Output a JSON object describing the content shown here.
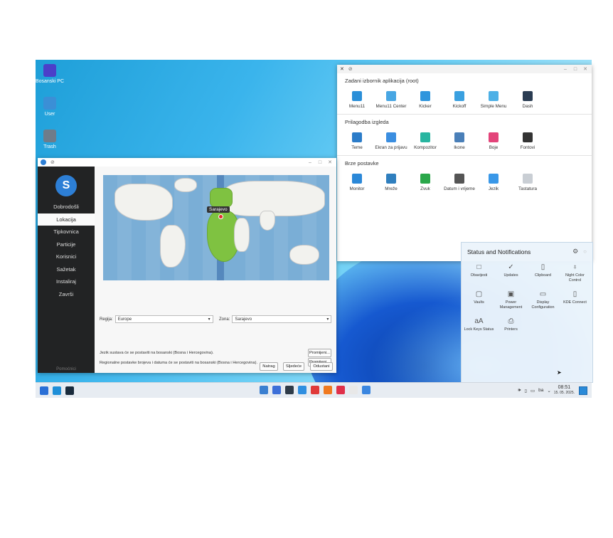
{
  "desktop": {
    "icons": [
      {
        "label": "Bosanski PC",
        "color": "#4b3fc9"
      },
      {
        "label": "User",
        "color": "#3b8fd6"
      },
      {
        "label": "Trash",
        "color": "#6f7c8a"
      }
    ]
  },
  "menu_window": {
    "sections": [
      {
        "title": "Zadani izbornik aplikacija (root)",
        "tiles": [
          {
            "label": "Menu11",
            "color": "#2a8fd8"
          },
          {
            "label": "Menu11 Center",
            "color": "#48a6e3"
          },
          {
            "label": "Kicker",
            "color": "#2f95dd"
          },
          {
            "label": "Kickoff",
            "color": "#3aa0e0"
          },
          {
            "label": "Simple Menu",
            "color": "#4db0e6"
          },
          {
            "label": "Dash",
            "color": "#2a3c52"
          }
        ]
      },
      {
        "title": "Prilagodba izgleda",
        "tiles": [
          {
            "label": "Teme",
            "color": "#2b7cc9"
          },
          {
            "label": "Ekran za prijavu",
            "color": "#3b8ee0"
          },
          {
            "label": "Kompozitor",
            "color": "#28b5a0"
          },
          {
            "label": "Ikone",
            "color": "#4a7fb8"
          },
          {
            "label": "Boje",
            "color": "#e3447a"
          },
          {
            "label": "Fontovi",
            "color": "#333333"
          }
        ]
      },
      {
        "title": "Brze postavke",
        "tiles": [
          {
            "label": "Monitor",
            "color": "#2b88d8"
          },
          {
            "label": "Mreže",
            "color": "#2f7fbe"
          },
          {
            "label": "Zvuk",
            "color": "#2aa74a"
          },
          {
            "label": "Datum i vrijeme",
            "color": "#555555"
          },
          {
            "label": "Jezik",
            "color": "#3a98e8"
          },
          {
            "label": "Tastatura",
            "color": "#c9ced4"
          }
        ]
      }
    ]
  },
  "installer": {
    "logo_glyph": "S",
    "sidebar": [
      "Dobrodošli",
      "Lokacija",
      "Tipkovnica",
      "Particije",
      "Korisnici",
      "Sažetak",
      "Instaliraj",
      "Završi"
    ],
    "active_index": 1,
    "footer": "Pomoćnici",
    "map_tooltip": "Sarajevo",
    "region_label": "Regija:",
    "region_value": "Europe",
    "zone_label": "Zona:",
    "zone_value": "Sarajevo",
    "note_language": "Jezik sustava će se postaviti na bosanski (Bosna i Hercegovina).",
    "note_regional": "Regionalne postavke brojeva i datuma će se postaviti na bosanski (Bosna i Hercegovina).",
    "change_label": "Promijeni...",
    "back_label": "Natrag",
    "next_label": "Sljedeće",
    "cancel_label": "Odustani"
  },
  "status_panel": {
    "title": "Status and Notifications",
    "items": [
      {
        "label": "Obavijesti",
        "icon": "bell-icon",
        "glyph": "□"
      },
      {
        "label": "Updates",
        "icon": "check-circle-icon",
        "glyph": "✓"
      },
      {
        "label": "Clipboard",
        "icon": "clipboard-icon",
        "glyph": "▯"
      },
      {
        "label": "Night Color Control",
        "icon": "bulb-icon",
        "glyph": "♁"
      },
      {
        "label": "Vaults",
        "icon": "vault-icon",
        "glyph": "▢"
      },
      {
        "label": "Power Management",
        "icon": "battery-icon",
        "glyph": "▣"
      },
      {
        "label": "Display Configuration",
        "icon": "display-icon",
        "glyph": "▭"
      },
      {
        "label": "KDE Connect",
        "icon": "phone-icon",
        "glyph": "▯"
      },
      {
        "label": "Lock Keys Status",
        "icon": "lock-keys-icon",
        "glyph": "aA"
      },
      {
        "label": "Printers",
        "icon": "printer-icon",
        "glyph": "⎙"
      }
    ]
  },
  "taskbar": {
    "keyboard_layout": "ba",
    "time": "08:51",
    "date": "15. 05. 2025.",
    "left_icons": [
      {
        "name": "app-menu-icon",
        "color": "#2a6fd6"
      },
      {
        "name": "settings-app-icon",
        "color": "#1f8fd8"
      },
      {
        "name": "terminal-app-icon",
        "color": "#1a2b3c"
      }
    ],
    "center_icons": [
      {
        "name": "file-manager-icon",
        "color": "#3a7fd0"
      },
      {
        "name": "store-icon",
        "color": "#3d6fd8"
      },
      {
        "name": "system-monitor-icon",
        "color": "#2e3b48"
      },
      {
        "name": "discover-icon",
        "color": "#2f8fe0"
      },
      {
        "name": "media-player-icon",
        "color": "#e03a3a"
      },
      {
        "name": "firefox-icon",
        "color": "#f07a20"
      },
      {
        "name": "music-icon",
        "color": "#e0304a"
      },
      {
        "name": "x-tool-icon",
        "color": "#e8e8e8"
      },
      {
        "name": "installer-icon",
        "color": "#3a86e0"
      }
    ]
  }
}
